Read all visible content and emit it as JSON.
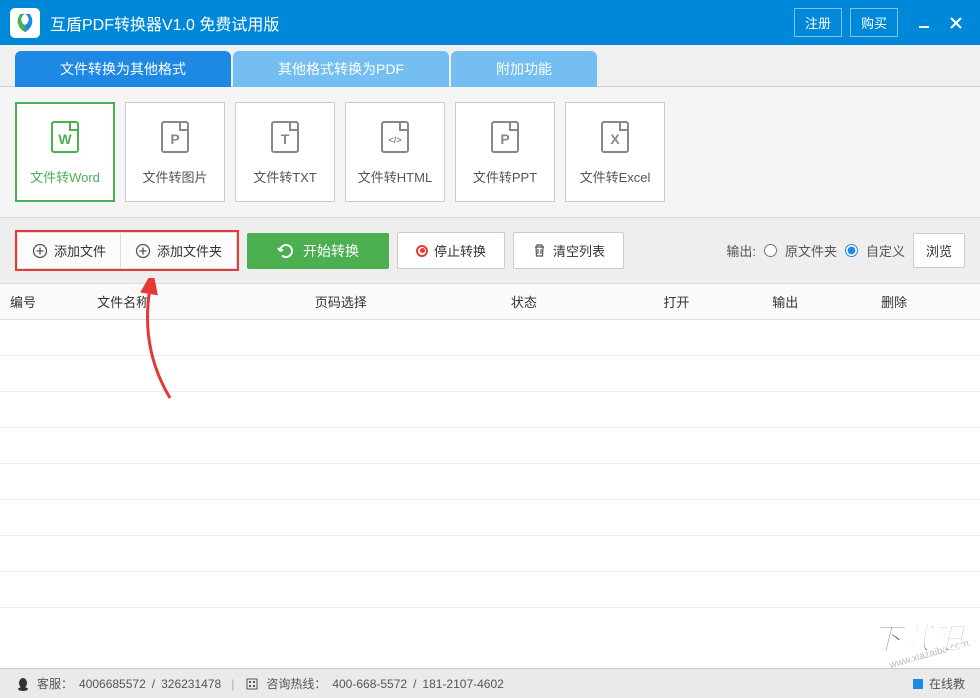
{
  "titlebar": {
    "app_title": "互盾PDF转换器V1.0 免费试用版",
    "register": "注册",
    "buy": "购买"
  },
  "main_tabs": [
    {
      "label": "文件转换为其他格式",
      "active": true
    },
    {
      "label": "其他格式转换为PDF",
      "active": false
    },
    {
      "label": "附加功能",
      "active": false
    }
  ],
  "formats": [
    {
      "label": "文件转Word",
      "active": true,
      "letter": "W"
    },
    {
      "label": "文件转图片",
      "active": false,
      "letter": "P"
    },
    {
      "label": "文件转TXT",
      "active": false,
      "letter": "T"
    },
    {
      "label": "文件转HTML",
      "active": false,
      "letter": "</>"
    },
    {
      "label": "文件转PPT",
      "active": false,
      "letter": "P"
    },
    {
      "label": "文件转Excel",
      "active": false,
      "letter": "X"
    }
  ],
  "actions": {
    "add_file": "添加文件",
    "add_folder": "添加文件夹",
    "start": "开始转换",
    "stop": "停止转换",
    "clear": "清空列表",
    "output_label": "输出:",
    "opt_original": "原文件夹",
    "opt_custom": "自定义",
    "browse": "浏览"
  },
  "table": {
    "col_index": "编号",
    "col_filename": "文件名称",
    "col_page": "页码选择",
    "col_status": "状态",
    "col_open": "打开",
    "col_output": "输出",
    "col_delete": "删除"
  },
  "footer": {
    "service": "客服：",
    "phone1": "4006685572",
    "phone2": "326231478",
    "hotline": "咨询热线：",
    "hot1": "400-668-5572",
    "hot2": "181-2107-4602",
    "tutorial": "在线教",
    "watermark_url": "www.xiazaiba.com",
    "download_badge": "下载吧"
  }
}
